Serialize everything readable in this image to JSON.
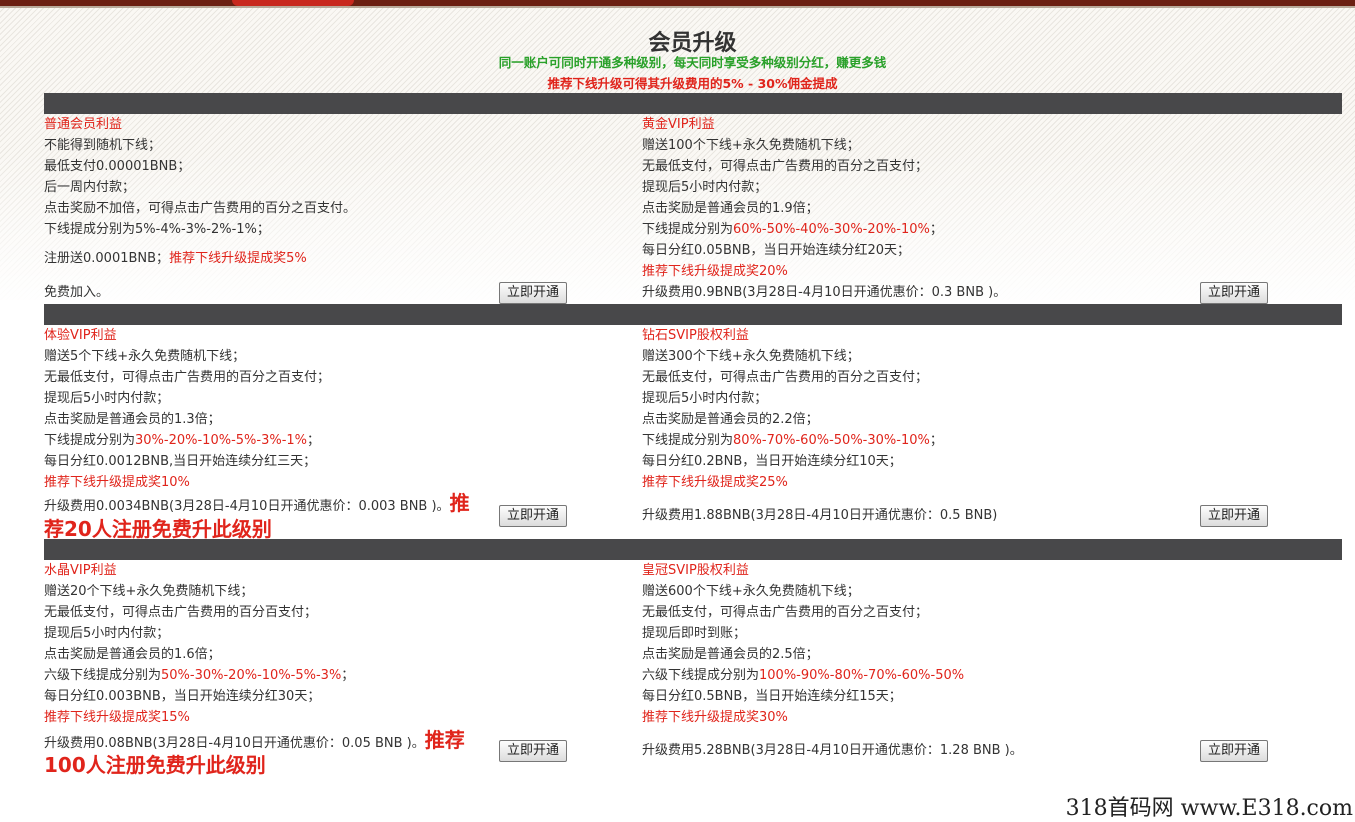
{
  "header": {
    "title": "会员升级",
    "subtitle_green": "同一账户可同时开通多种级别，每天同时享受多种级别分红，赚更多钱",
    "subtitle_red": "推荐下线升级可得其升级费用的5% - 30%佣金提成"
  },
  "button_label": "立即开通",
  "cards": {
    "normal": {
      "title": "普通会员利益",
      "lines": [
        "不能得到随机下线；",
        "最低支付0.00001BNB；",
        "后一周内付款；",
        "点击奖励不加倍，可得点击广告费用的百分之百支付。",
        "下线提成分别为5%-4%-3%-2%-1%；"
      ],
      "reg_prefix": "注册送0.0001BNB；",
      "reg_red": "推荐下线升级提成奖5%",
      "price": "免费加入。"
    },
    "gold": {
      "title": "黄金VIP利益",
      "lines": [
        "赠送100个下线+永久免费随机下线；",
        "无最低支付，可得点击广告费用的百分之百支付；",
        "提现后5小时内付款；",
        "点击奖励是普通会员的1.9倍；"
      ],
      "comm_prefix": "下线提成分别为",
      "comm_red": "60%-50%-40%-30%-20%-10%",
      "comm_suffix": "；",
      "daily": "每日分红0.05BNB，当日开始连续分红20天；",
      "reward": "推荐下线升级提成奖20%",
      "price": "升级费用0.9BNB(3月28日-4月10日开通优惠价：0.3 BNB )。"
    },
    "trial": {
      "title": "体验VIP利益",
      "lines": [
        "赠送5个下线+永久免费随机下线；",
        "无最低支付，可得点击广告费用的百分之百支付；",
        "提现后5小时内付款；",
        "点击奖励是普通会员的1.3倍；"
      ],
      "comm_prefix": "下线提成分别为",
      "comm_red": "30%-20%-10%-5%-3%-1%",
      "comm_suffix": "；",
      "daily": "每日分红0.0012BNB,当日开始连续分红三天；",
      "reward": "推荐下线升级提成奖10%",
      "price": "升级费用0.0034BNB(3月28日-4月10日开通优惠价：0.003 BNB )。",
      "promo_a": "推",
      "promo_b": "荐20人注册免费升此级别"
    },
    "diamond": {
      "title": "钻石SVIP股权利益",
      "lines": [
        "赠送300个下线+永久免费随机下线；",
        "无最低支付，可得点击广告费用的百分之百支付；",
        "提现后5小时内付款；",
        "点击奖励是普通会员的2.2倍；"
      ],
      "comm_prefix": "下线提成分别为",
      "comm_red": "80%-70%-60%-50%-30%-10%",
      "comm_suffix": "；",
      "daily": "每日分红0.2BNB，当日开始连续分红10天；",
      "reward": "推荐下线升级提成奖25%",
      "price": "升级费用1.88BNB(3月28日-4月10日开通优惠价：0.5 BNB)"
    },
    "crystal": {
      "title": "水晶VIP利益",
      "lines": [
        "赠送20个下线+永久免费随机下线；",
        "无最低支付，可得点击广告费用的百分百支付；",
        "提现后5小时内付款；",
        "点击奖励是普通会员的1.6倍；"
      ],
      "comm_prefix": "六级下线提成分别为",
      "comm_red": "50%-30%-20%-10%-5%-3%",
      "comm_suffix": "；",
      "daily": "每日分红0.003BNB，当日开始连续分红30天；",
      "reward": "推荐下线升级提成奖15%",
      "price": "升级费用0.08BNB(3月28日-4月10日开通优惠价：0.05 BNB )。",
      "promo_a": "推荐",
      "promo_b": "100人注册免费升此级别"
    },
    "crown": {
      "title": "皇冠SVIP股权利益",
      "lines": [
        "赠送600个下线+永久免费随机下线；",
        "无最低支付，可得点击广告费用的百分之百支付；",
        "提现后即时到账；",
        "点击奖励是普通会员的2.5倍；"
      ],
      "comm_prefix": "六级下线提成分别为",
      "comm_red": "100%-90%-80%-70%-60%-50%",
      "comm_suffix": "",
      "daily": "每日分红0.5BNB，当日开始连续分红15天；",
      "reward": "推荐下线升级提成奖30%",
      "price": "升级费用5.28BNB(3月28日-4月10日开通优惠价：1.28 BNB )。"
    }
  },
  "watermark": "318首码网 www.E318.com",
  "colors": {
    "accent_red": "#e0241b",
    "accent_green": "#2aa12a",
    "bar": "#48484a"
  }
}
